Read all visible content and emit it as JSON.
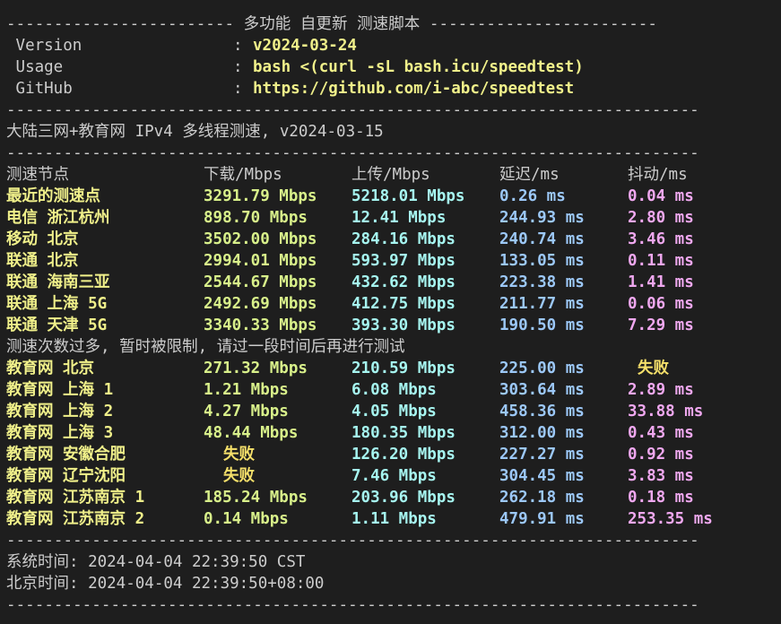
{
  "header": {
    "title_line": "------------------------ 多功能 自更新 测速脚本 ------------------------",
    "rows": [
      {
        "label": " Version",
        "colon": ":",
        "value": "v2024-03-24"
      },
      {
        "label": " Usage",
        "colon": ":",
        "value": "bash <(curl -sL bash.icu/speedtest)"
      },
      {
        "label": " GitHub",
        "colon": ":",
        "value": "https://github.com/i-abc/speedtest"
      }
    ]
  },
  "divider": "-------------------------------------------------------------------------",
  "section_title": "大陆三网+教育网 IPv4 多线程测速, v2024-03-15",
  "columns": {
    "node": "测速节点",
    "download": "下载/Mbps",
    "upload": "上传/Mbps",
    "latency": "延迟/ms",
    "jitter": "抖动/ms"
  },
  "results_a": [
    {
      "node": "最近的测速点",
      "download": "3291.79 Mbps",
      "upload": "5218.01 Mbps",
      "latency": "0.26 ms",
      "jitter": "0.04 ms"
    },
    {
      "node": "电信 浙江杭州",
      "download": "898.70 Mbps",
      "upload": "12.41 Mbps",
      "latency": "244.93 ms",
      "jitter": "2.80 ms"
    },
    {
      "node": "移动 北京",
      "download": "3502.00 Mbps",
      "upload": "284.16 Mbps",
      "latency": "240.74 ms",
      "jitter": "3.46 ms"
    },
    {
      "node": "联通 北京",
      "download": "2994.01 Mbps",
      "upload": "593.97 Mbps",
      "latency": "133.05 ms",
      "jitter": "0.11 ms"
    },
    {
      "node": "联通 海南三亚",
      "download": "2544.67 Mbps",
      "upload": "432.62 Mbps",
      "latency": "223.38 ms",
      "jitter": "1.41 ms"
    },
    {
      "node": "联通 上海 5G",
      "download": "2492.69 Mbps",
      "upload": "412.75 Mbps",
      "latency": "211.77 ms",
      "jitter": "0.06 ms"
    },
    {
      "node": "联通 天津 5G",
      "download": "3340.33 Mbps",
      "upload": "393.30 Mbps",
      "latency": "190.50 ms",
      "jitter": "7.29 ms"
    }
  ],
  "rate_limit_notice": "测速次数过多, 暂时被限制, 请过一段时间后再进行测试",
  "results_b": [
    {
      "node": "教育网 北京",
      "download": "271.32 Mbps",
      "upload": "210.59 Mbps",
      "latency": "225.00 ms",
      "jitter": "失败",
      "jitter_fail": true
    },
    {
      "node": "教育网 上海 1",
      "download": "1.21 Mbps",
      "upload": "6.08 Mbps",
      "latency": "303.64 ms",
      "jitter": "2.89 ms"
    },
    {
      "node": "教育网 上海 2",
      "download": "4.27 Mbps",
      "upload": "4.05 Mbps",
      "latency": "458.36 ms",
      "jitter": "33.88 ms"
    },
    {
      "node": "教育网 上海 3",
      "download": "48.44 Mbps",
      "upload": "180.35 Mbps",
      "latency": "312.00 ms",
      "jitter": "0.43 ms"
    },
    {
      "node": "教育网 安徽合肥",
      "download": "失败",
      "download_fail": true,
      "upload": "126.20 Mbps",
      "latency": "227.27 ms",
      "jitter": "0.92 ms"
    },
    {
      "node": "教育网 辽宁沈阳",
      "download": "失败",
      "download_fail": true,
      "upload": "7.46 Mbps",
      "latency": "304.45 ms",
      "jitter": "3.83 ms"
    },
    {
      "node": "教育网 江苏南京 1",
      "download": "185.24 Mbps",
      "upload": "203.96 Mbps",
      "latency": "262.18 ms",
      "jitter": "0.18 ms"
    },
    {
      "node": "教育网 江苏南京 2",
      "download": "0.14 Mbps",
      "upload": "1.11 Mbps",
      "latency": "479.91 ms",
      "jitter": "253.35 ms"
    }
  ],
  "footer": {
    "system_time": "系统时间: 2024-04-04 22:39:50 CST",
    "beijing_time": "北京时间: 2024-04-04 22:39:50+08:00"
  },
  "colors": {
    "background": "#1e1e1e",
    "text": "#cccccc",
    "node": "#f0f08a",
    "download": "#d8f08a",
    "upload": "#a6f5f0",
    "latency": "#9cc8f8",
    "jitter": "#f0a8f0",
    "fail": "#f5e06a"
  }
}
